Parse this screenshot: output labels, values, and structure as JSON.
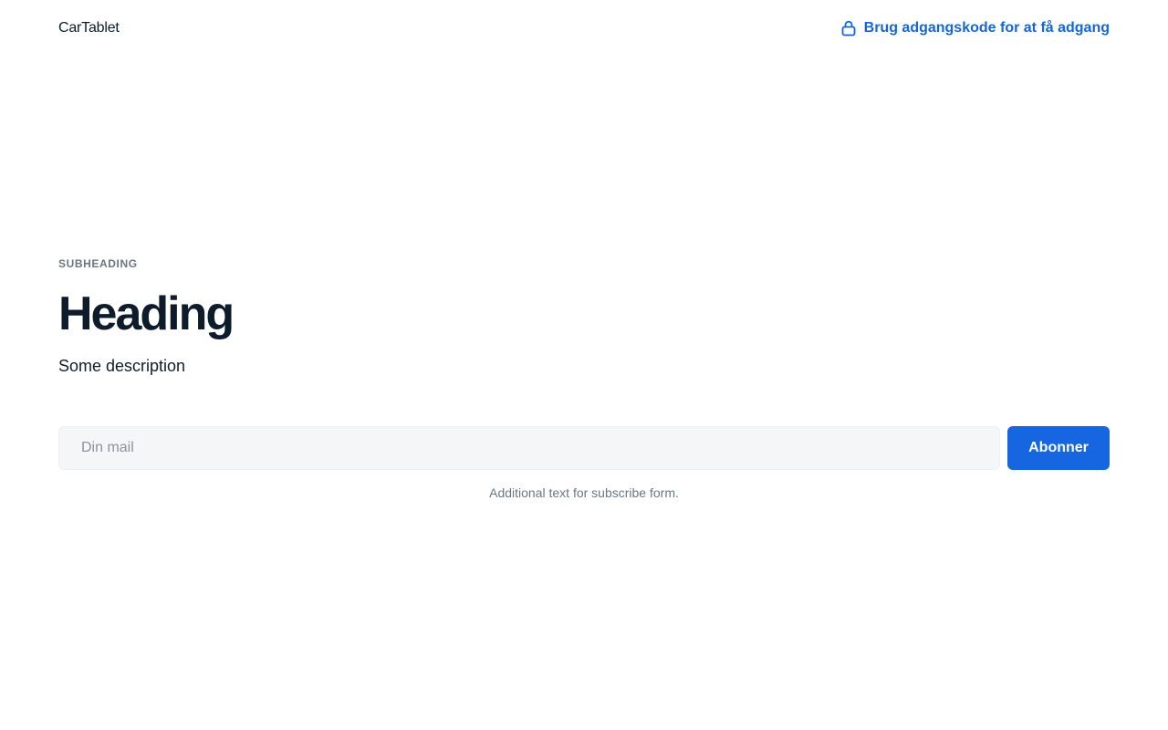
{
  "header": {
    "brand": "CarTablet",
    "password_link": "Brug adgangskode for at få adgang",
    "lock_icon": "lock-icon",
    "link_color": "#1566d6"
  },
  "hero": {
    "subheading": "SUBHEADING",
    "heading": "Heading",
    "description": "Some description"
  },
  "subscribe": {
    "email_placeholder": "Din mail",
    "email_value": "",
    "button_label": "Abonner",
    "button_color": "#1566e0",
    "note": "Additional text for subscribe form."
  }
}
